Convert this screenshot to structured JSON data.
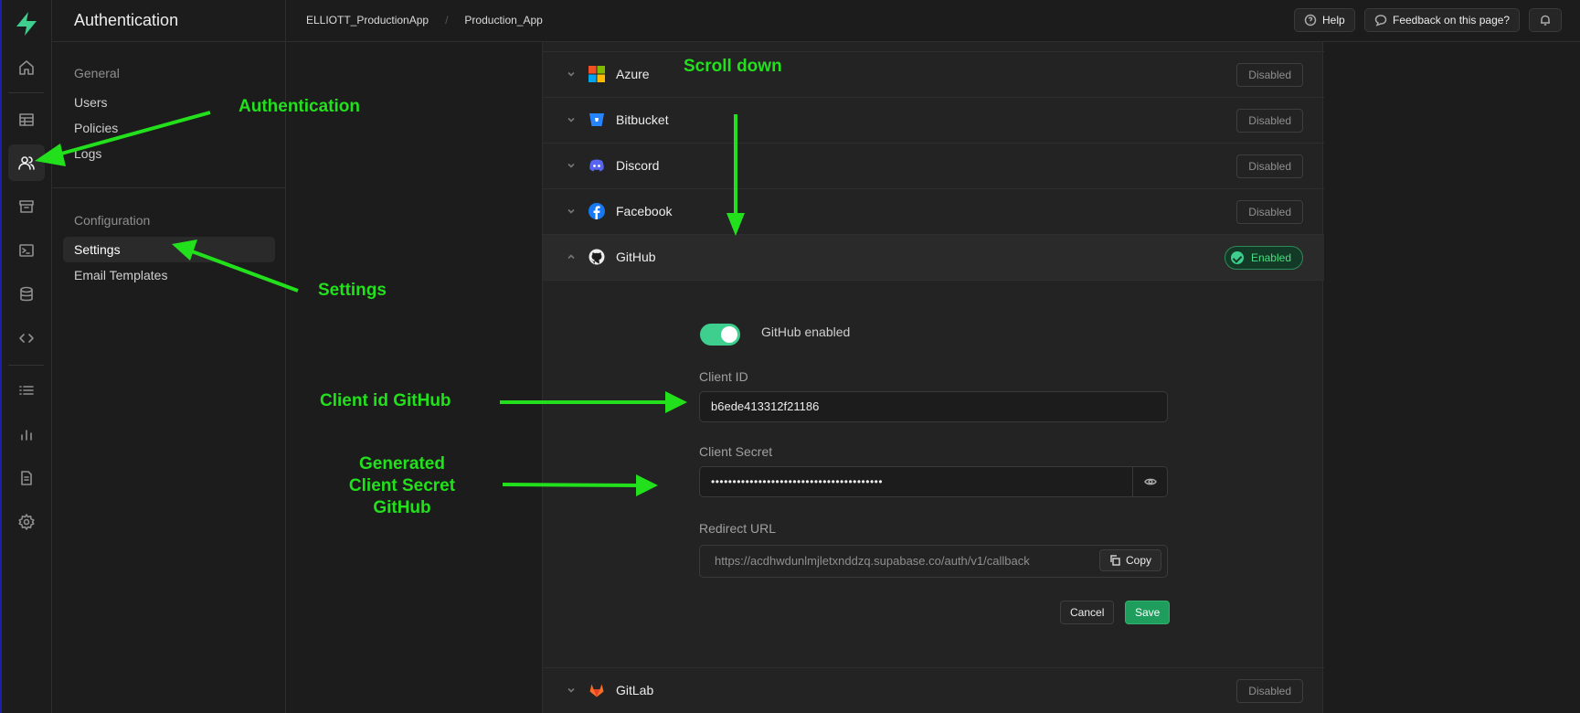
{
  "header": {
    "title": "Authentication",
    "breadcrumbs": [
      "ELLIOTT_ProductionApp",
      "Production_App"
    ],
    "help_label": "Help",
    "feedback_label": "Feedback on this page?"
  },
  "sidebar": {
    "general_heading": "General",
    "general_items": [
      "Users",
      "Policies",
      "Logs"
    ],
    "config_heading": "Configuration",
    "config_items": [
      "Settings",
      "Email Templates"
    ],
    "selected": "Settings"
  },
  "rail_icons": [
    "home-icon",
    "table-editor-icon",
    "users-icon",
    "storage-icon",
    "sql-terminal-icon",
    "database-icon",
    "code-icon",
    "logs-list-icon",
    "reports-chart-icon",
    "docs-icon",
    "settings-gear-icon"
  ],
  "providers": [
    {
      "name": "Azure",
      "status": "Disabled",
      "icon": "azure-icon"
    },
    {
      "name": "Bitbucket",
      "status": "Disabled",
      "icon": "bitbucket-icon"
    },
    {
      "name": "Discord",
      "status": "Disabled",
      "icon": "discord-icon"
    },
    {
      "name": "Facebook",
      "status": "Disabled",
      "icon": "facebook-icon"
    },
    {
      "name": "GitHub",
      "status": "Enabled",
      "icon": "github-icon"
    },
    {
      "name": "GitLab",
      "status": "Disabled",
      "icon": "gitlab-icon"
    }
  ],
  "github_form": {
    "toggle_label": "GitHub enabled",
    "client_id_label": "Client ID",
    "client_id_value": "b6ede413312f21186",
    "client_secret_label": "Client Secret",
    "client_secret_value": "••••••••••••••••••••••••••••••••••••••••",
    "redirect_label": "Redirect URL",
    "redirect_value": "https://acdhwdunlmjletxnddzq.supabase.co/auth/v1/callback",
    "copy_label": "Copy",
    "cancel_label": "Cancel",
    "save_label": "Save"
  },
  "annotations": {
    "authentication": "Authentication",
    "settings": "Settings",
    "scroll_down": "Scroll down",
    "client_id": "Client id GitHub",
    "client_secret_line1": "Generated",
    "client_secret_line2": "Client Secret",
    "client_secret_line3": "GitHub"
  },
  "colors": {
    "accent": "#3ecf8e",
    "annotation": "#22e01b",
    "background": "#1c1c1c"
  }
}
